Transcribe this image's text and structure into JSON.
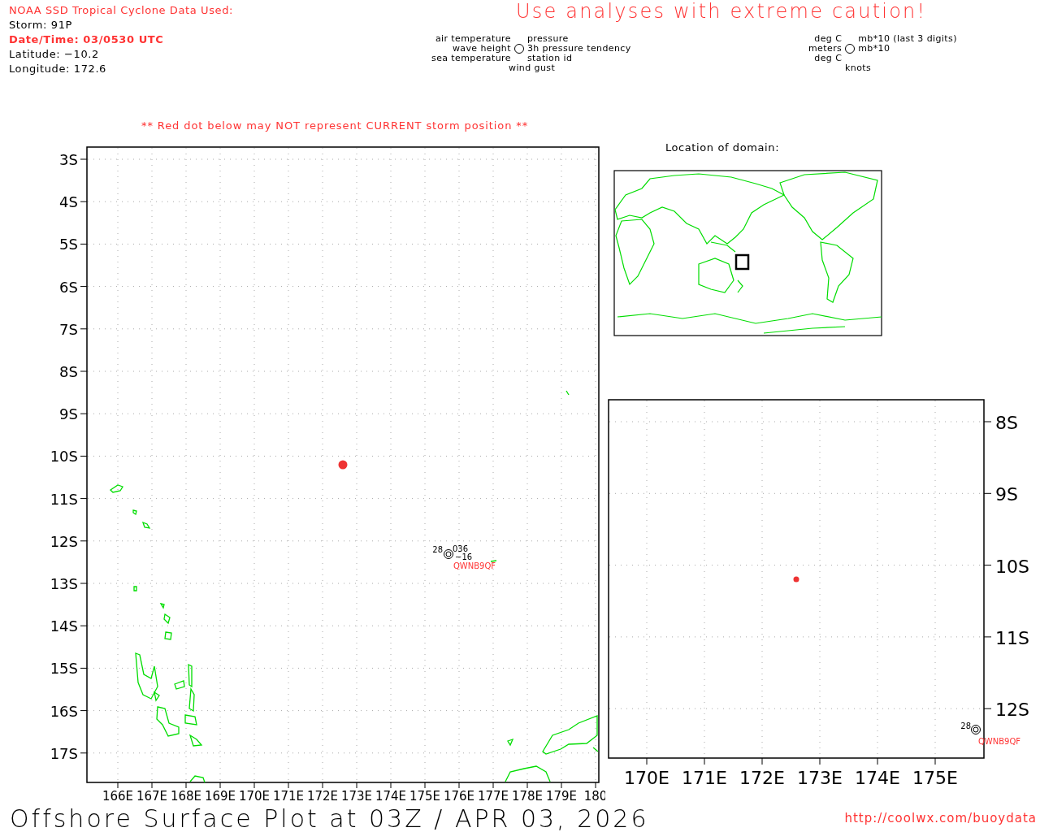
{
  "info": {
    "source_title": "NOAA SSD Tropical Cyclone Data Used:",
    "storm": "Storm: 91P",
    "datetime": "Date/Time: 03/0530 UTC",
    "latitude": "Latitude: −10.2",
    "longitude": "Longitude: 172.6"
  },
  "caution": "Use analyses with extreme caution!",
  "legend": {
    "left": [
      "air temperature",
      "wave height",
      "sea temperature"
    ],
    "right": [
      "pressure",
      "3h pressure tendency",
      "station id"
    ],
    "bottom": "wind gust"
  },
  "units": {
    "left": [
      "deg C",
      "meters",
      "deg C"
    ],
    "right": [
      "mb*10 (last 3 digits)",
      "mb*10"
    ],
    "bottom": "knots"
  },
  "warning": "** Red dot below may NOT represent CURRENT storm position **",
  "main_map": {
    "lat_labels": [
      "3S",
      "4S",
      "5S",
      "6S",
      "7S",
      "8S",
      "9S",
      "10S",
      "11S",
      "12S",
      "13S",
      "14S",
      "15S",
      "16S",
      "17S"
    ],
    "lon_labels": [
      "166E",
      "167E",
      "168E",
      "169E",
      "170E",
      "171E",
      "172E",
      "173E",
      "174E",
      "175E",
      "176E",
      "177E",
      "178E",
      "179E",
      "180"
    ],
    "station": {
      "temperature": "28",
      "pressure": "036",
      "tendency": "−16",
      "id": "QWNB9QF"
    }
  },
  "domain": {
    "title": "Location of domain:"
  },
  "inset_map": {
    "lat_labels": [
      "8S",
      "9S",
      "10S",
      "11S",
      "12S"
    ],
    "lon_labels": [
      "170E",
      "171E",
      "172E",
      "173E",
      "174E",
      "175E"
    ],
    "station": {
      "temperature": "28",
      "id": "QWNB9QF"
    }
  },
  "footer": {
    "title": "Offshore Surface Plot at 03Z / APR 03, 2026",
    "url": "http://coolwx.com/buoydata"
  }
}
